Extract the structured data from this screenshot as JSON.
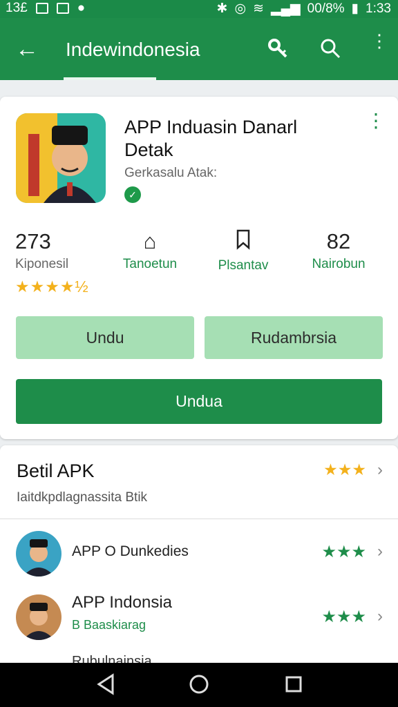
{
  "status": {
    "left_text": "13£",
    "battery": "00/8%",
    "time": "1:33"
  },
  "appbar": {
    "title": "Indewindonesia"
  },
  "app": {
    "title_line1": "APP Induasin Danarl",
    "title_line2": "Detak",
    "developer": "Gerkasalu Atak:",
    "stats": [
      {
        "value": "273",
        "label": "Kiponesil"
      },
      {
        "value": "",
        "label": "Tanoetun"
      },
      {
        "value": "",
        "label": "Plsantav"
      },
      {
        "value": "82",
        "label": "Nairobun"
      }
    ],
    "rating_stars": "★★★★½",
    "buttons": {
      "secondary_left": "Undu",
      "secondary_right": "Rudambrsia",
      "primary": "Undua"
    }
  },
  "section": {
    "title": "Betil APK",
    "subtitle": "Iaitdkpdlagnassita Btik",
    "stars": "★★★",
    "items": [
      {
        "title": "APP O Dunkedies",
        "subtitle": "",
        "stars": "★★★"
      },
      {
        "title": "APP Indonsia",
        "subtitle": "B Baaskiarag",
        "stars": "★★★"
      },
      {
        "title": "Rubulnainsia",
        "subtitle": "",
        "stars": ""
      }
    ]
  },
  "colors": {
    "brand": "#1e8d4a",
    "light": "#a6dfb4",
    "star": "#f3b11c"
  }
}
